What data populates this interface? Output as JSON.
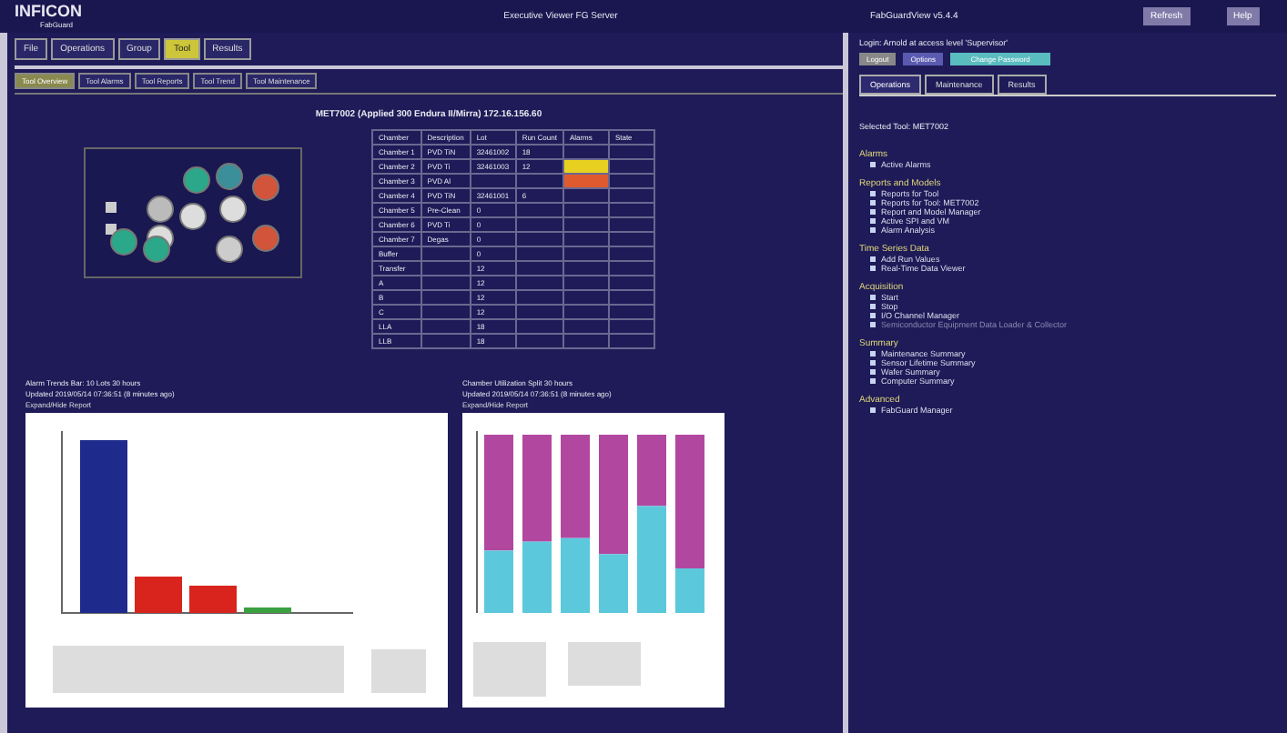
{
  "header": {
    "logo": "INFICON",
    "logo_sub": "FabGuard",
    "title": "Executive Viewer FG Server",
    "version": "FabGuardView v5.4.4",
    "buttons": [
      "Refresh",
      "Help"
    ]
  },
  "menu_tabs": [
    {
      "label": "File",
      "selected": false
    },
    {
      "label": "Operations",
      "selected": false
    },
    {
      "label": "Group",
      "selected": false
    },
    {
      "label": "Tool",
      "selected": true
    },
    {
      "label": "Results",
      "selected": false
    }
  ],
  "sub_tabs": [
    {
      "label": "Tool Overview",
      "selected": true
    },
    {
      "label": "Tool Alarms",
      "selected": false
    },
    {
      "label": "Tool Reports",
      "selected": false
    },
    {
      "label": "Tool Trend",
      "selected": false
    },
    {
      "label": "Tool Maintenance",
      "selected": false
    }
  ],
  "tool_title": "MET7002 (Applied 300 Endura II/Mirra) 172.16.156.60",
  "table": {
    "columns": [
      "Chamber",
      "Description",
      "Lot",
      "Run Count",
      "Alarms",
      "State"
    ],
    "rows": [
      {
        "cells": [
          "Chamber 1",
          "PVD TiN",
          "32461002",
          "18",
          "",
          ""
        ]
      },
      {
        "cells": [
          "Chamber 2",
          "PVD Ti",
          "32461003",
          "12",
          "",
          ""
        ],
        "color": "#e8d020"
      },
      {
        "cells": [
          "Chamber 3",
          "PVD Al",
          "",
          "",
          "",
          ""
        ],
        "color": "#e05a30"
      },
      {
        "cells": [
          "Chamber 4",
          "PVD TiN",
          "32461001",
          "6",
          "",
          ""
        ]
      },
      {
        "cells": [
          "Chamber 5",
          "Pre-Clean",
          "0",
          "",
          "",
          ""
        ]
      },
      {
        "cells": [
          "Chamber 6",
          "PVD Ti",
          "0",
          "",
          "",
          ""
        ]
      },
      {
        "cells": [
          "Chamber 7",
          "Degas",
          "0",
          "",
          "",
          ""
        ]
      },
      {
        "cells": [
          "Buffer",
          "",
          "0",
          "",
          "",
          ""
        ]
      },
      {
        "cells": [
          "Transfer",
          "",
          "12",
          "",
          "",
          ""
        ]
      },
      {
        "cells": [
          "A",
          "",
          "12",
          "",
          "",
          ""
        ]
      },
      {
        "cells": [
          "B",
          "",
          "12",
          "",
          "",
          ""
        ]
      },
      {
        "cells": [
          "C",
          "",
          "12",
          "",
          "",
          ""
        ]
      },
      {
        "cells": [
          "LLA",
          "",
          "18",
          "",
          "",
          ""
        ]
      },
      {
        "cells": [
          "LLB",
          "",
          "18",
          "",
          "",
          ""
        ]
      }
    ]
  },
  "charts": [
    {
      "title": "Alarm Trends Bar: 10 Lots 30 hours",
      "updated": "Updated 2019/05/14 07:36:51 (8 minutes ago)",
      "link": "Expand/Hide Report"
    },
    {
      "title": "Chamber Utilization Split 30 hours",
      "updated": "Updated 2019/05/14 07:36:51 (8 minutes ago)",
      "link": "Expand/Hide Report"
    }
  ],
  "right_panel": {
    "login": "Login: Arnold at access level 'Supervisor'",
    "buttons": [
      "Logout",
      "Options",
      "Change Password"
    ],
    "tabs": [
      {
        "label": "Operations",
        "selected": true
      },
      {
        "label": "Maintenance",
        "selected": false
      },
      {
        "label": "Results",
        "selected": false
      }
    ],
    "selected_tool": "Selected Tool: MET7002",
    "sections": [
      {
        "heading": "Alarms",
        "items": [
          {
            "label": "Active Alarms",
            "disabled": false
          }
        ]
      },
      {
        "heading": "Reports and Models",
        "items": [
          {
            "label": "Reports for Tool",
            "disabled": false
          },
          {
            "label": "Reports for Tool: MET7002",
            "disabled": false
          },
          {
            "label": "Report and Model Manager",
            "disabled": false
          },
          {
            "label": "Active SPI and VM",
            "disabled": false
          },
          {
            "label": "Alarm Analysis",
            "disabled": false
          }
        ]
      },
      {
        "heading": "Time Series Data",
        "items": [
          {
            "label": "Add Run Values",
            "disabled": false
          },
          {
            "label": "Real-Time Data Viewer",
            "disabled": false
          }
        ]
      },
      {
        "heading": "Acquisition",
        "items": [
          {
            "label": "Start",
            "disabled": false
          },
          {
            "label": "Stop",
            "disabled": false
          },
          {
            "label": "I/O Channel Manager",
            "disabled": false
          },
          {
            "label": "Semiconductor Equipment Data Loader & Collector",
            "disabled": true
          }
        ]
      },
      {
        "heading": "Summary",
        "items": [
          {
            "label": "Maintenance Summary",
            "disabled": false
          },
          {
            "label": "Sensor Lifetime Summary",
            "disabled": false
          },
          {
            "label": "Wafer Summary",
            "disabled": false
          },
          {
            "label": "Computer Summary",
            "disabled": false
          }
        ]
      },
      {
        "heading": "Advanced",
        "items": [
          {
            "label": "FabGuard Manager",
            "disabled": false
          }
        ]
      }
    ]
  }
}
